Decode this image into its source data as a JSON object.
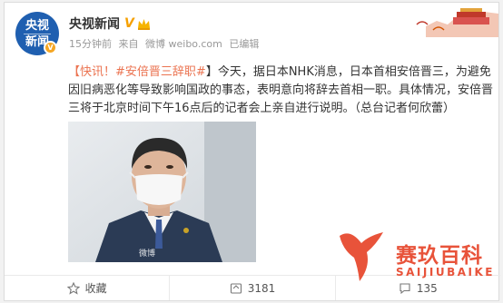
{
  "account": {
    "avatar_line1": "央视",
    "avatar_line2": "新闻",
    "name": "央视新闻",
    "vip_mark": "V"
  },
  "meta": {
    "time": "15分钟前",
    "source_prefix": "来自",
    "source": "微博 weibo.com",
    "edited": "已编辑"
  },
  "post": {
    "prefix": "【快讯！",
    "topic": "#安倍晋三辞职#",
    "prefix_end": "】",
    "body": "今天，据日本NHK消息，日本首相安倍晋三，为避免因旧病恶化等导致影响国政的事态，表明意向将辞去首相一职。具体情况，安倍晋三将于北京时间下午16点后的记者会上亲自进行说明。（总台记者何欣蕾）"
  },
  "photo": {
    "watermark": "微博"
  },
  "actions": {
    "collect": "收藏",
    "repost": "3181",
    "comment": "135"
  },
  "logo": {
    "title": "赛玖百科",
    "subtitle": "SAIJIUBAIKE"
  },
  "colors": {
    "link": "#eb7350",
    "avatar_bg": "#1f5fb0",
    "logo": "#e8533a"
  }
}
